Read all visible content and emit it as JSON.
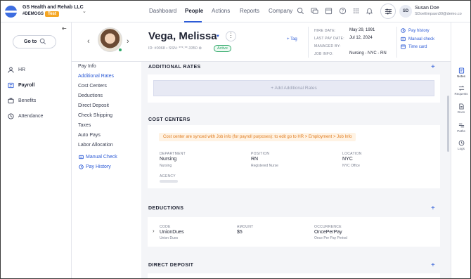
{
  "app": {
    "company_name": "GS Health and Rehab LLC",
    "company_code": "#DEMOGS",
    "env_badge": "Test"
  },
  "topnav": {
    "items": [
      {
        "label": "Dashboard",
        "active": false
      },
      {
        "label": "People",
        "active": true
      },
      {
        "label": "Actions",
        "active": false
      },
      {
        "label": "Reports",
        "active": false
      },
      {
        "label": "Company",
        "active": false
      }
    ],
    "icons": [
      "search-icon",
      "chat-icon",
      "calendar-icon",
      "help-icon",
      "apps-grid-icon",
      "bell-icon",
      "settings-sliders-icon"
    ]
  },
  "user": {
    "initials": "SD",
    "name": "Susan Doe",
    "email": "SDoeEmpasn30@demo.co"
  },
  "leftnav": {
    "goto_label": "Go to",
    "items": [
      {
        "label": "HR",
        "icon": "person-icon",
        "active": false
      },
      {
        "label": "Payroll",
        "icon": "payroll-icon",
        "active": true
      },
      {
        "label": "Benefits",
        "icon": "benefits-icon",
        "active": false
      },
      {
        "label": "Attendance",
        "icon": "clock-icon",
        "active": false
      }
    ]
  },
  "employee": {
    "name": "Vega, Melissa",
    "id_line": "ID: #0068 • SSN: ***-**-3350 ⊗",
    "status": "Active",
    "add_tag": "+ Tag",
    "info": [
      {
        "label": "HIRE DATE:",
        "value": "May 29, 1991"
      },
      {
        "label": "LAST PAY DATE:",
        "value": "Jul 12, 2024"
      },
      {
        "label": "MANAGED BY:",
        "value": ""
      },
      {
        "label": "JOB INFO:",
        "value": "Nursing - NYC - RN"
      }
    ],
    "quick_links": [
      {
        "label": "Pay history",
        "icon": "pay-history-icon"
      },
      {
        "label": "Manual check",
        "icon": "manual-check-icon"
      },
      {
        "label": "Time card",
        "icon": "time-card-icon"
      }
    ]
  },
  "subnav": {
    "items": [
      {
        "label": "Pay Info",
        "active": false
      },
      {
        "label": "Additional Rates",
        "active": true
      },
      {
        "label": "Cost Centers",
        "active": false
      },
      {
        "label": "Deductions",
        "active": false
      },
      {
        "label": "Direct Deposit",
        "active": false
      },
      {
        "label": "Check Shipping",
        "active": false
      },
      {
        "label": "Taxes",
        "active": false
      },
      {
        "label": "Auto Pays",
        "active": false
      },
      {
        "label": "Labor Allocation",
        "active": false
      }
    ],
    "links": [
      {
        "label": "Manual Check",
        "icon": "manual-check-icon"
      },
      {
        "label": "Pay History",
        "icon": "pay-history-icon"
      }
    ]
  },
  "sections": {
    "additional_rates": {
      "title": "ADDITIONAL RATES",
      "add_button": "+ Add Additional Rates"
    },
    "cost_centers": {
      "title": "COST CENTERS",
      "notice": "Cost center are synced with Job info (for payroll purposes): to edit go to HR > Employment > Job Info",
      "fields": [
        {
          "label": "DEPARTMENT",
          "value": "Nursing",
          "sub": "Nursing"
        },
        {
          "label": "POSITION",
          "value": "RN",
          "sub": "Registered Nurse"
        },
        {
          "label": "LOCATION",
          "value": "NYC",
          "sub": "NYC Office"
        }
      ],
      "agency_label": "AGENCY"
    },
    "deductions": {
      "title": "DEDUCTIONS",
      "fields": [
        {
          "label": "CODE",
          "value": "UnionDues",
          "sub": "Union Dues"
        },
        {
          "label": "AMOUNT",
          "value": "$5",
          "sub": ""
        },
        {
          "label": "OCCURRENCE",
          "value": "OncePerPay",
          "sub": "Once Per Pay Period"
        }
      ]
    },
    "direct_deposit": {
      "title": "DIRECT DEPOSIT"
    }
  },
  "rightrail": {
    "items": [
      {
        "label": "Notes",
        "icon": "notes-icon"
      },
      {
        "label": "Requests",
        "icon": "requests-icon"
      },
      {
        "label": "Docs",
        "icon": "docs-icon"
      },
      {
        "label": "Paths",
        "icon": "paths-icon"
      },
      {
        "label": "Logs",
        "icon": "logs-icon"
      }
    ]
  },
  "colors": {
    "accent": "#2d5bd6",
    "active_green": "#2ea868",
    "test_badge": "#f5a623",
    "notice_text": "#e07b1d",
    "notice_bg": "#fff3e4",
    "content_bg": "#f4f5f8"
  }
}
